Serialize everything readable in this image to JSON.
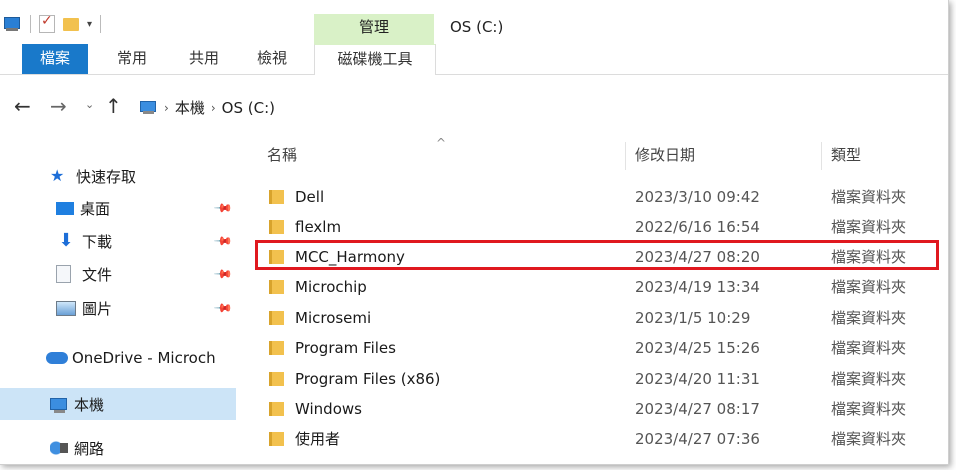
{
  "titlebar": {
    "manage_tab": "管理",
    "title": "OS (C:)"
  },
  "ribbon": {
    "tabs": [
      "檔案",
      "常用",
      "共用",
      "檢視",
      "磁碟機工具"
    ]
  },
  "address": {
    "crumbs": [
      "本機",
      "OS (C:)"
    ]
  },
  "navpane": {
    "items": [
      {
        "label": "快速存取",
        "icon": "star-icon"
      },
      {
        "label": "桌面",
        "icon": "desktop-icon"
      },
      {
        "label": "下載",
        "icon": "download-icon"
      },
      {
        "label": "文件",
        "icon": "document-icon"
      },
      {
        "label": "圖片",
        "icon": "pictures-icon"
      },
      {
        "label": "OneDrive - Microch",
        "icon": "onedrive-icon"
      },
      {
        "label": "本機",
        "icon": "pc-icon"
      },
      {
        "label": "網路",
        "icon": "network-icon"
      }
    ]
  },
  "list": {
    "columns": {
      "name": "名稱",
      "date": "修改日期",
      "type": "類型"
    },
    "rows": [
      {
        "name": "Dell",
        "date": "2023/3/10 09:42",
        "type": "檔案資料夾"
      },
      {
        "name": "flexlm",
        "date": "2022/6/16 16:54",
        "type": "檔案資料夾"
      },
      {
        "name": "MCC_Harmony",
        "date": "2023/4/27 08:20",
        "type": "檔案資料夾"
      },
      {
        "name": "Microchip",
        "date": "2023/4/19 13:34",
        "type": "檔案資料夾"
      },
      {
        "name": "Microsemi",
        "date": "2023/1/5 10:29",
        "type": "檔案資料夾"
      },
      {
        "name": "Program Files",
        "date": "2023/4/25 15:26",
        "type": "檔案資料夾"
      },
      {
        "name": "Program Files (x86)",
        "date": "2023/4/20 11:31",
        "type": "檔案資料夾"
      },
      {
        "name": "Windows",
        "date": "2023/4/27 08:17",
        "type": "檔案資料夾"
      },
      {
        "name": "使用者",
        "date": "2023/4/27 07:36",
        "type": "檔案資料夾"
      }
    ]
  },
  "colors": {
    "file_tab": "#1979ca",
    "manage_tab": "#d9f1c7",
    "selection": "#cce4f7",
    "highlight_box": "#e0181f",
    "folder": "#f2c14e"
  }
}
